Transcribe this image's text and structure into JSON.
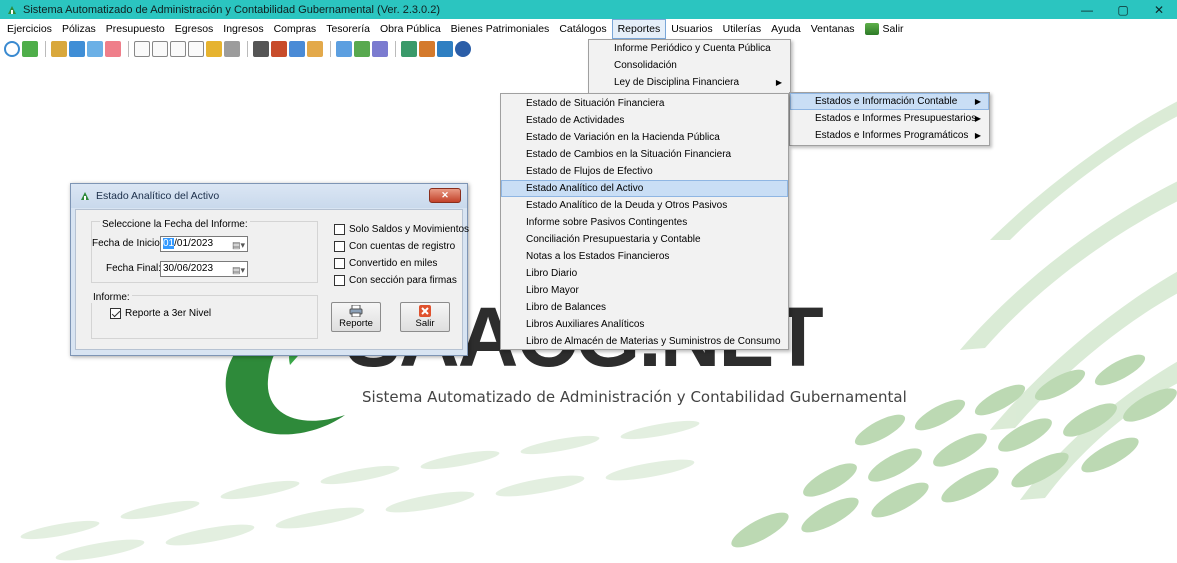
{
  "window": {
    "title": "Sistema Automatizado de Administración y Contabilidad Gubernamental  (Ver. 2.3.0.2)",
    "controls": {
      "minimize": "—",
      "maximize": "▢",
      "close": "✕"
    }
  },
  "menubar": {
    "items": [
      "Ejercicios",
      "Pólizas",
      "Presupuesto",
      "Egresos",
      "Ingresos",
      "Compras",
      "Tesorería",
      "Obra Pública",
      "Bienes Patrimoniales",
      "Catálogos",
      "Reportes",
      "Usuarios",
      "Utilerías",
      "Ayuda",
      "Ventanas",
      "Salir"
    ],
    "active": "Reportes"
  },
  "reportes_menu": {
    "items": [
      "Informe Periódico y Cuenta Pública",
      "Consolidación",
      "Ley de Disciplina Financiera",
      "Estados e Información Contable"
    ]
  },
  "estados_submenu": {
    "items": [
      "Estados e Información Contable",
      "Estados e Informes Presupuestarios",
      "Estados e Informes Programáticos"
    ]
  },
  "contable_submenu": {
    "items": [
      "Estado de Situación Financiera",
      "Estado de Actividades",
      "Estado de Variación en la Hacienda Pública",
      "Estado de Cambios en la Situación Financiera",
      "Estado de Flujos de Efectivo",
      "Estado Analítico del Activo",
      "Estado Analítico de la Deuda y Otros Pasivos",
      "Informe sobre Pasivos Contingentes",
      "Conciliación Presupuestaria y Contable",
      "Notas a los Estados Financieros",
      "Libro Diario",
      "Libro Mayor",
      "Libro de Balances",
      "Libros Auxiliares Analíticos",
      "Libro de Almacén de Materias y Suministros de Consumo"
    ],
    "highlighted": "Estado Analítico del Activo"
  },
  "background": {
    "logo_text": "SAACG.NET",
    "subtitle": "Sistema Automatizado de Administración y Contabilidad Gubernamental"
  },
  "dialog": {
    "title": "Estado Analítico del Activo",
    "close_label": "✕",
    "fecha_group_label": "Seleccione la Fecha del Informe:",
    "fecha_inicio_label": "Fecha de Inicio:",
    "fecha_inicio_sel": "01",
    "fecha_inicio_rest": "/01/2023",
    "fecha_final_label": "Fecha Final:",
    "fecha_final_value": "30/06/2023",
    "informe_group_label": "Informe:",
    "reporte_nivel_label": "Reporte a 3er Nivel",
    "reporte_nivel_checked": true,
    "options": [
      {
        "label": "Solo Saldos y Movimientos",
        "checked": false
      },
      {
        "label": "Con cuentas de registro",
        "checked": false
      },
      {
        "label": "Convertido en miles",
        "checked": false
      },
      {
        "label": "Con sección para firmas",
        "checked": false
      }
    ],
    "reporte_button": "Reporte",
    "salir_button": "Salir"
  },
  "colors": {
    "titlebar": "#2bc5c0",
    "brand_green": "#3a9a3a",
    "menu_highlight": "#c9def5"
  }
}
